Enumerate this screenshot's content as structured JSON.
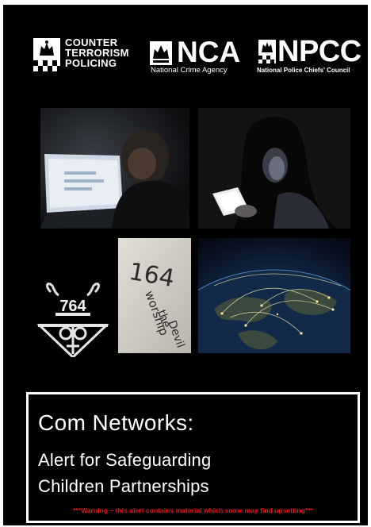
{
  "logos": {
    "ctp": {
      "line1": "COUNTER",
      "line2": "TERRORISM",
      "line3": "POLICING"
    },
    "nca": {
      "abbr": "NCA",
      "name": "National Crime Agency"
    },
    "npcc": {
      "abbr": "NPCC",
      "name": "National Police Chiefs' Council"
    }
  },
  "images": {
    "emblem_number": "764",
    "wall_text": [
      "164",
      "worship",
      "the",
      "Devil"
    ]
  },
  "alert": {
    "title": "Com Networks:",
    "subtitle_line1": "Alert for Safeguarding",
    "subtitle_line2": "Children Partnerships",
    "warning": "***Warning – this alert contains material which some may find upsetting***"
  },
  "colors": {
    "background": "#000000",
    "text": "#ffffff",
    "warning": "#e8141b"
  }
}
